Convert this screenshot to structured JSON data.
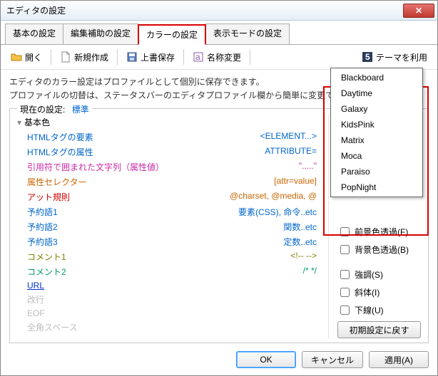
{
  "window": {
    "title": "エディタの設定"
  },
  "tabs": [
    "基本の設定",
    "編集補助の設定",
    "カラーの設定",
    "表示モードの設定"
  ],
  "active_tab_index": 2,
  "toolbar": {
    "open": "開く",
    "new": "新規作成",
    "save": "上書保存",
    "rename": "名称変更",
    "theme": "テーマを利用"
  },
  "hints": {
    "line1": "エディタのカラー設定はプロファイルとして個別に保存できます。",
    "line2": "プロファイルの切替は、ステータスバーのエディタプロファイル欄から簡単に変更できます。"
  },
  "group": {
    "legend": "現在の設定:",
    "current": "標準"
  },
  "categories": {
    "base": "基本色"
  },
  "items": [
    {
      "name": "HTMLタグの要素",
      "sample": "<ELEMENT...>",
      "ncolor": "#0066cc",
      "scolor": "#0066cc"
    },
    {
      "name": "HTMLタグの属性",
      "sample": "ATTRIBUTE=",
      "ncolor": "#0066cc",
      "scolor": "#0066cc"
    },
    {
      "name": "引用符で囲まれた文字列（属性値）",
      "sample": "\".....\"",
      "ncolor": "#c72aa8",
      "scolor": "#c72aa8"
    },
    {
      "name": "属性セレクター",
      "sample": "[attr=value]",
      "ncolor": "#cc6600",
      "scolor": "#cc6600"
    },
    {
      "name": "アット規則",
      "sample": "@charset, @media, @",
      "ncolor": "#cc0000",
      "scolor": "#cc6600"
    },
    {
      "name": "予約語1",
      "sample": "要素(CSS), 命令..etc",
      "ncolor": "#0066cc",
      "scolor": "#0066cc"
    },
    {
      "name": "予約語2",
      "sample": "関数..etc",
      "ncolor": "#0066cc",
      "scolor": "#0066cc"
    },
    {
      "name": "予約語3",
      "sample": "定数..etc",
      "ncolor": "#0066cc",
      "scolor": "#0066cc"
    },
    {
      "name": "コメント1",
      "sample": "<!-- -->",
      "ncolor": "#808000",
      "scolor": "#808000"
    },
    {
      "name": "コメント2",
      "sample": "/* */",
      "ncolor": "#009966",
      "scolor": "#009966"
    },
    {
      "name": "URL",
      "sample": "",
      "ncolor": "#0033cc",
      "scolor": "",
      "underline": true
    },
    {
      "name": "改行",
      "sample": "",
      "ncolor": "#bcbcbc",
      "scolor": ""
    },
    {
      "name": "EOF",
      "sample": "",
      "ncolor": "#bcbcbc",
      "scolor": ""
    },
    {
      "name": "全角スペース",
      "sample": "",
      "ncolor": "#bcbcbc",
      "scolor": ""
    }
  ],
  "side": {
    "fg_trans": "前景色透過(F)",
    "bg_trans": "背景色透過(B)",
    "bold": "強調(S)",
    "italic": "斜体(I)",
    "underline": "下線(U)",
    "reset": "初期設定に戻す"
  },
  "themes": [
    "Blackboard",
    "Daytime",
    "Galaxy",
    "KidsPink",
    "Matrix",
    "Moca",
    "Paraiso",
    "PopNight"
  ],
  "buttons": {
    "ok": "OK",
    "cancel": "キャンセル",
    "apply": "適用(A)"
  }
}
